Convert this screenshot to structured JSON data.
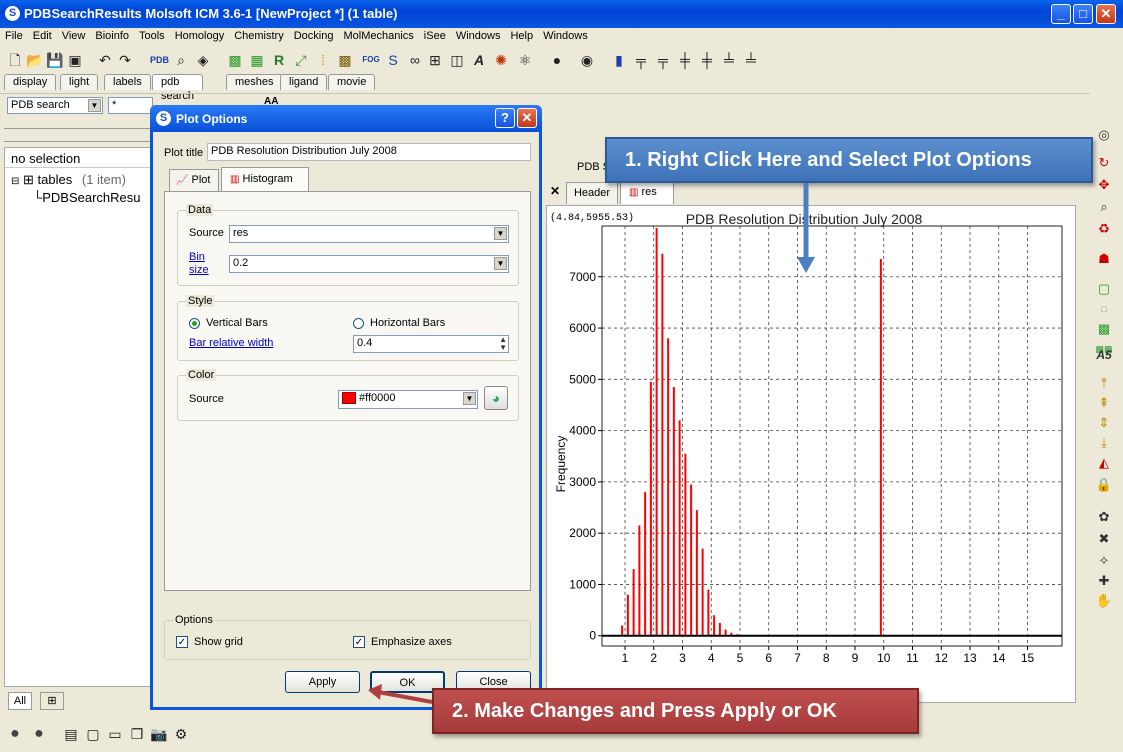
{
  "window": {
    "title": "PDBSearchResults Molsoft ICM 3.6-1 [NewProject *] (1 table)",
    "app_icon": "S",
    "minimize": "_",
    "maximize": "□",
    "close": "✕"
  },
  "menu": [
    "File",
    "Edit",
    "View",
    "Bioinfo",
    "Tools",
    "Homology",
    "Chemistry",
    "Docking",
    "MolMechanics",
    "iSee",
    "Windows",
    "Help",
    "Windows"
  ],
  "tabs": [
    "display",
    "light",
    "labels",
    "pdb search",
    "meshes",
    "ligand",
    "movie"
  ],
  "search": {
    "mode": "PDB search",
    "query": "*",
    "extra": "AA"
  },
  "left_panel": {
    "header": "no selection",
    "tree_root": "tables",
    "tree_count": "(1 item)",
    "tree_child": "PDBSearchResu"
  },
  "bottom_tabs": {
    "all": "All",
    "grid": "⊞"
  },
  "plot_area": {
    "pane_label": "PDB S",
    "tabs": [
      "Header",
      "res"
    ],
    "close": "✕",
    "coords": "(4.84,5955.53)"
  },
  "dialog": {
    "title": "Plot Options",
    "help": "?",
    "close": "✕",
    "plot_title_label": "Plot title",
    "plot_title_value": "PDB Resolution Distribution July 2008",
    "tabs": [
      "Plot",
      "Histogram"
    ],
    "data_group": "Data",
    "source_label": "Source",
    "source_value": "res",
    "bin_label_1": "Bin",
    "bin_label_2": "size",
    "bin_value": "0.2",
    "style_group": "Style",
    "vertical_bars": "Vertical Bars",
    "horizontal_bars": "Horizontal Bars",
    "bar_width_label": "Bar relative width",
    "bar_width_value": "0.4",
    "color_group": "Color",
    "color_source_label": "Source",
    "color_value": "#ff0000",
    "options_group": "Options",
    "show_grid": "Show grid",
    "emphasize_axes": "Emphasize axes",
    "apply": "Apply",
    "ok": "OK",
    "close_btn": "Close"
  },
  "callouts": {
    "one": "1. Right Click Here and Select Plot Options",
    "two": "2. Make Changes and Press Apply or OK"
  },
  "chart_data": {
    "type": "bar",
    "title": "PDB Resolution Distribution July 2008",
    "xlabel": "res",
    "ylabel": "Frequency",
    "xlim": [
      0.2,
      16.2
    ],
    "ylim": [
      -200,
      7990
    ],
    "xticks": [
      1,
      2,
      3,
      4,
      5,
      6,
      7,
      8,
      9,
      10,
      11,
      12,
      13,
      14,
      15
    ],
    "yticks": [
      0,
      1000,
      2000,
      3000,
      4000,
      5000,
      6000,
      7000
    ],
    "grid": true,
    "color": "#ff0000",
    "x": [
      0.9,
      1.1,
      1.3,
      1.5,
      1.7,
      1.9,
      2.1,
      2.3,
      2.5,
      2.7,
      2.9,
      3.1,
      3.3,
      3.5,
      3.7,
      3.9,
      4.1,
      4.3,
      4.5,
      4.7,
      4.9,
      9.9
    ],
    "values": [
      200,
      800,
      1300,
      2150,
      2800,
      4950,
      7950,
      7450,
      5800,
      4850,
      4200,
      3550,
      2950,
      2450,
      1700,
      900,
      400,
      250,
      120,
      60,
      30,
      7350
    ]
  }
}
